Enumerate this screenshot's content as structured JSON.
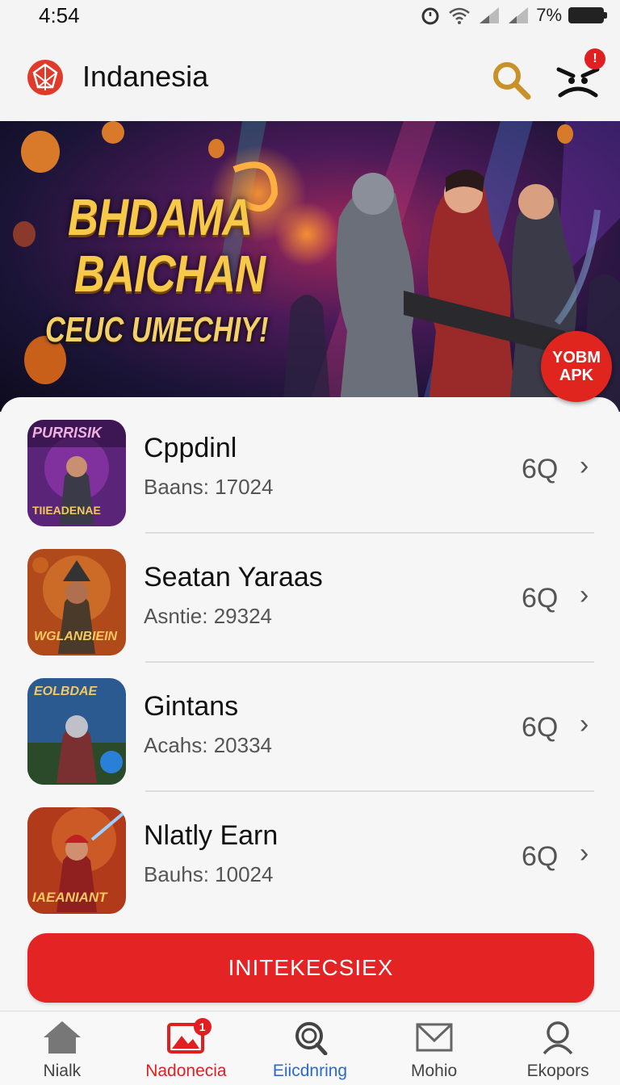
{
  "status_bar": {
    "time": "4:54",
    "battery_text": "7%",
    "battery_icon_text": "7/8"
  },
  "header": {
    "title": "Indanesia",
    "notification_count": "!"
  },
  "banner": {
    "line1": "BHDAMA",
    "line2": "BAICHAN",
    "line3": "CEUC UMECHIY!",
    "badge_line1": "YOBM",
    "badge_line2": "APK"
  },
  "games": [
    {
      "name": "Cppdinl",
      "stat": "Baans: 17024",
      "action": "6Q",
      "thumb_top": "PURRISIK",
      "thumb_bottom": "TIIEADENAE",
      "thumb_colors": [
        "#6a2d8a",
        "#2a0f3a"
      ]
    },
    {
      "name": "Seatan Yaraas",
      "stat": "Asntie: 29324",
      "action": "6Q",
      "thumb_top": "",
      "thumb_bottom": "WGLANBIEIN",
      "thumb_colors": [
        "#c85a1a",
        "#3a1a08"
      ]
    },
    {
      "name": "Gintans",
      "stat": "Acahs: 20334",
      "action": "6Q",
      "thumb_top": "EOLBDAE",
      "thumb_bottom": "",
      "thumb_colors": [
        "#3a6aa8",
        "#0f2a48"
      ]
    },
    {
      "name": "Nlatly Earn",
      "stat": "Bauhs: 10024",
      "action": "6Q",
      "thumb_top": "",
      "thumb_bottom": "IAEANIANT",
      "thumb_colors": [
        "#c04020",
        "#3a0a05"
      ]
    }
  ],
  "cta": {
    "label": "INITEKECSIEX"
  },
  "nav": [
    {
      "label": "Nialk",
      "icon": "home-icon",
      "color": "#444"
    },
    {
      "label": "Nadonecia",
      "icon": "inbox-icon",
      "color": "#e02020",
      "badge": "1"
    },
    {
      "label": "Eiicdnring",
      "icon": "search-icon",
      "color": "#2a6acb"
    },
    {
      "label": "Mohio",
      "icon": "mail-icon",
      "color": "#444"
    },
    {
      "label": "Ekopors",
      "icon": "profile-icon",
      "color": "#444"
    }
  ],
  "colors": {
    "accent": "#e42424",
    "background": "#f3f3f3"
  }
}
